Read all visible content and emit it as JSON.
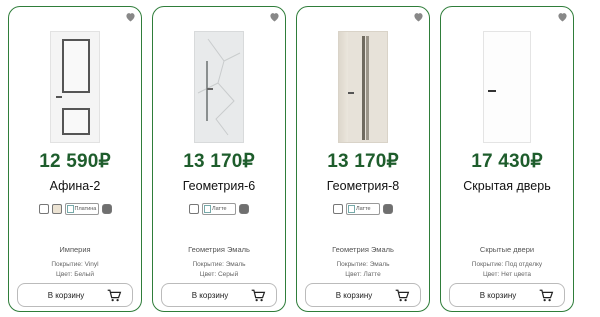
{
  "currency_sign": "₽",
  "cards": [
    {
      "price": "12 590₽",
      "name": "Афина-2",
      "swatches": [
        "white",
        "beige",
        "Платина",
        "grey"
      ],
      "collection": "Империя",
      "coating": "Покрытие: Vinyl",
      "color": "Цвет: Белый",
      "cart_label": "В корзину"
    },
    {
      "price": "13 170₽",
      "name": "Геометрия-6",
      "swatches": [
        "white",
        "Латте",
        "grey"
      ],
      "collection": "Геометрия Эмаль",
      "coating": "Покрытие: Эмаль",
      "color": "Цвет: Серый",
      "cart_label": "В корзину"
    },
    {
      "price": "13 170₽",
      "name": "Геометрия-8",
      "swatches": [
        "white",
        "Латте",
        "grey"
      ],
      "collection": "Геометрия Эмаль",
      "coating": "Покрытие: Эмаль",
      "color": "Цвет: Латте",
      "cart_label": "В корзину"
    },
    {
      "price": "17 430₽",
      "name": "Скрытая дверь",
      "swatches": [],
      "collection": "Скрытые двери",
      "coating": "Покрытие: Под отделку",
      "color": "Цвет: Нет цвета",
      "cart_label": "В корзину"
    }
  ],
  "icons": {
    "favorite": "heart-icon",
    "cart": "cart-icon"
  },
  "colors": {
    "accent": "#1e5d2c",
    "border": "#2f7d3a",
    "swatch_grey": "#6f6f6f",
    "swatch_beige": "#ece3d3"
  }
}
